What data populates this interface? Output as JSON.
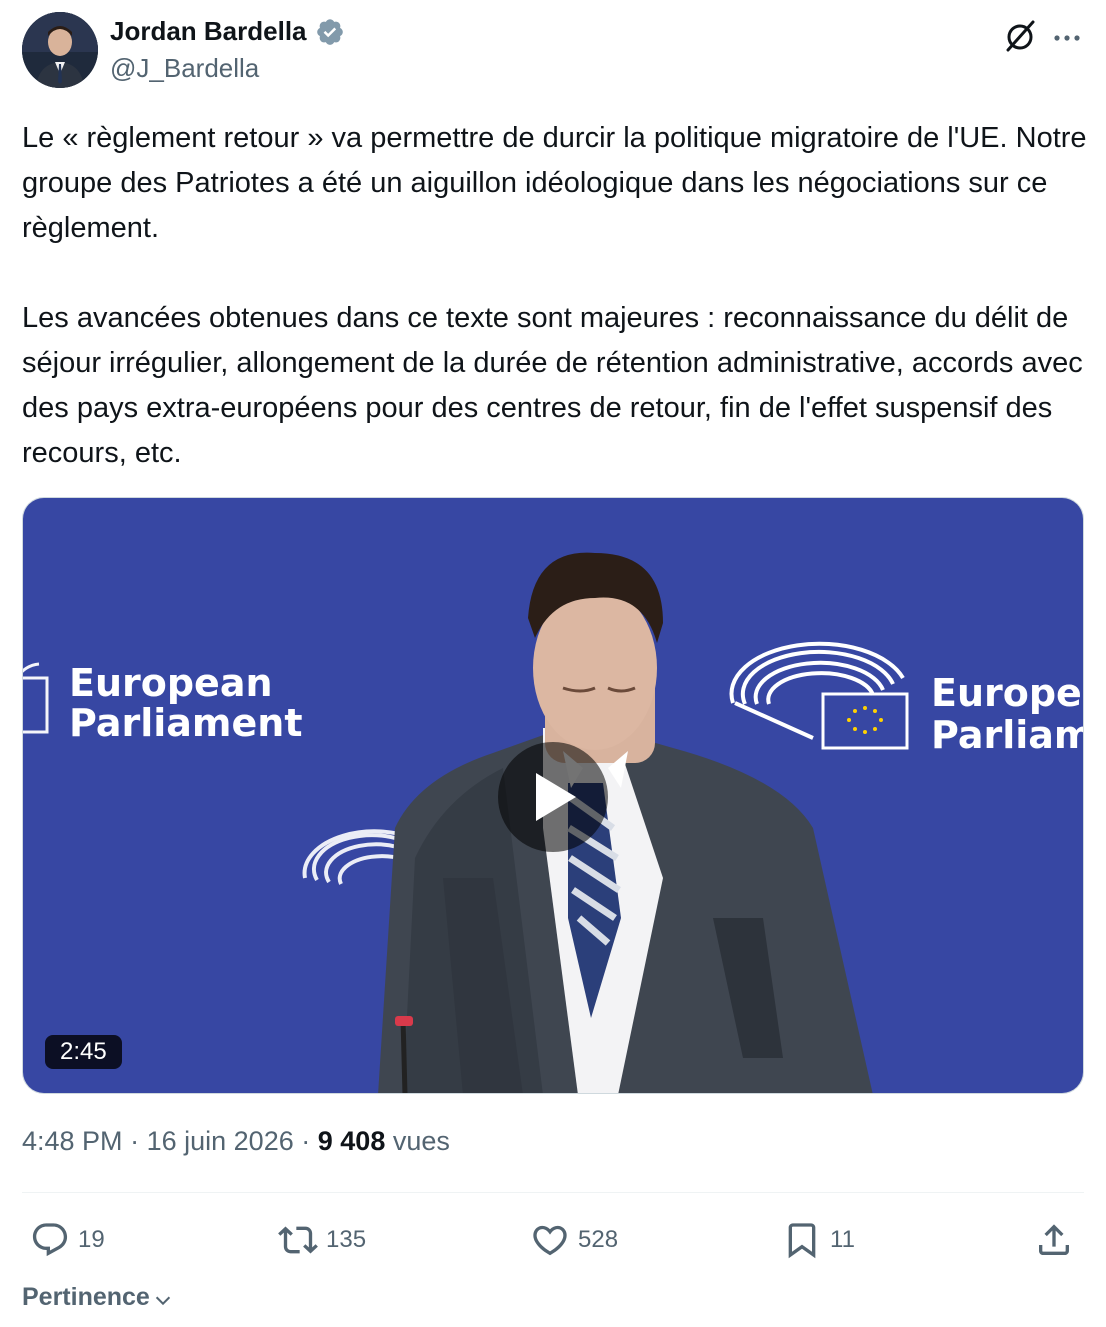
{
  "author": {
    "display_name": "Jordan Bardella",
    "handle": "@J_Bardella",
    "verified": true,
    "verified_color": "#829aab"
  },
  "tweet": {
    "paragraphs": [
      "Le « règlement retour » va permettre de durcir la politique migratoire de l'UE. Notre groupe des Patriotes a été un aiguillon idéologique dans les négociations sur ce règlement.",
      "Les avancées obtenues dans ce texte sont majeures : reconnaissance du délit de séjour irrégulier, allongement de la durée de rétention administrative, accords avec des pays extra-européens pour des centres de retour, fin de l'effet suspensif des recours, etc."
    ]
  },
  "media": {
    "duration": "2:45",
    "background_text": {
      "left_line1": "European",
      "left_line2": "Parliament",
      "right_line1": "Europe",
      "right_line2": "Parliam"
    },
    "background_color": "#3a4aa6"
  },
  "meta": {
    "time": "4:48 PM",
    "separator": "·",
    "date": "16 juin 2026",
    "views_count": "9 408",
    "views_label": "vues"
  },
  "actions": {
    "replies": "19",
    "reposts": "135",
    "likes": "528",
    "bookmarks": "11"
  },
  "icons": [
    "grok-icon",
    "more-icon",
    "verified-badge-icon",
    "reply-icon",
    "repost-icon",
    "like-icon",
    "bookmark-icon",
    "share-icon",
    "play-icon",
    "chevron-down-icon"
  ],
  "sort": {
    "label": "Pertinence"
  }
}
